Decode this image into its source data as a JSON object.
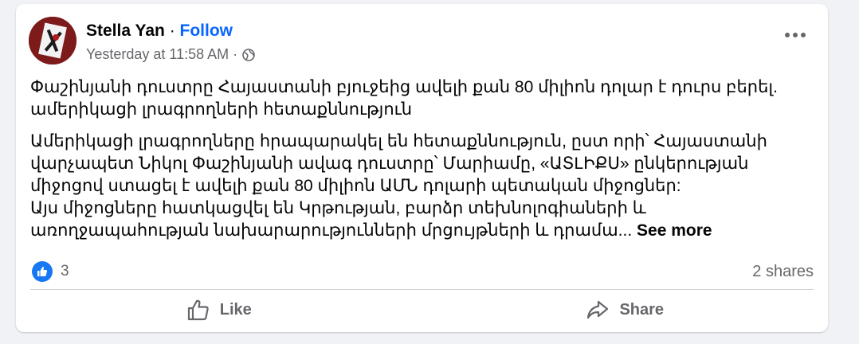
{
  "post": {
    "author": "Stella Yan",
    "separator": "·",
    "follow_label": "Follow",
    "timestamp": "Yesterday at 11:58 AM",
    "meta_separator": "·",
    "privacy_icon": "globe-icon",
    "menu_icon": "more-options-icon",
    "headline": "Փաշինյանի դուստրը Հայաստանի բյուջեից ավելի քան 80 միլիոն դոլար է դուրս բերել. ամերիկացի լրագրողների հետաքննություն",
    "body_line": "Ամերիկացի լրագրողները հրապարակել են հետաքննություն, ըստ որի՝ Հայաստանի վարչապետ Նիկոլ Փաշինյանի ավագ դուստրը՝ Մարիամը, «ԱՏLԻՔՍ» ընկերության միջոցով ստացել է ավելի քան 80 միլիոն ԱՄՆ դոլարի պետական միջոցներ:",
    "body_line2": "Այս միջոցները հատկացվել են Կրթության, բարձր տեխնոլոգիաների և առողջապահության նախարարությունների մրցույթների և դրամա...",
    "see_more": "See more"
  },
  "stats": {
    "reaction_icon": "like-reaction-icon",
    "reaction_count": "3",
    "shares": "2 shares"
  },
  "actions": {
    "like_label": "Like",
    "like_icon": "thumbs-up-icon",
    "share_label": "Share",
    "share_icon": "share-arrow-icon"
  },
  "colors": {
    "accent": "#0866ff",
    "like_badge": "#1877f2",
    "secondary_text": "#65676b",
    "background": "#f0f2f5"
  }
}
